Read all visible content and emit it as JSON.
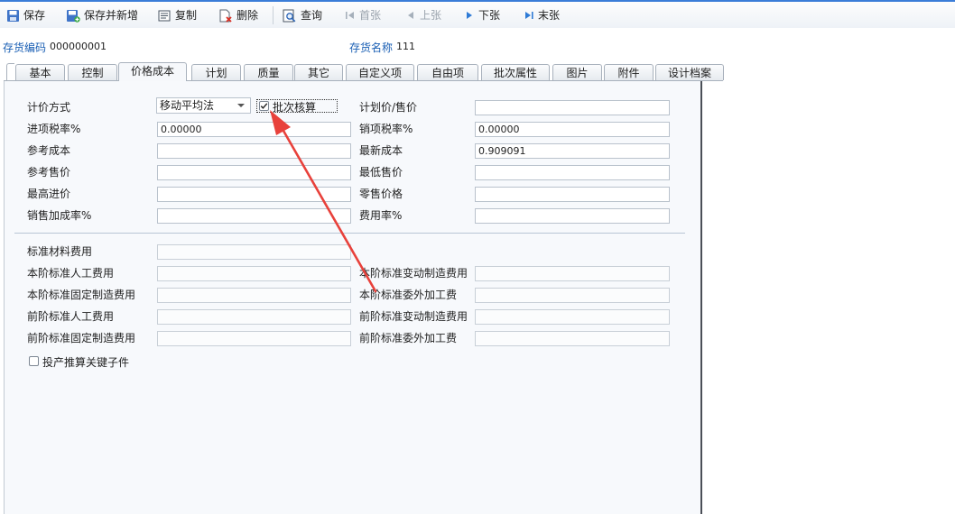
{
  "toolbar": {
    "save": "保存",
    "save_new": "保存并新增",
    "copy": "复制",
    "delete": "删除",
    "query": "查询",
    "first": "首张",
    "prev": "上张",
    "next": "下张",
    "last": "末张"
  },
  "header": {
    "code_label": "存货编码",
    "code_value": "000000001",
    "name_label": "存货名称",
    "name_value": "111"
  },
  "tabs": [
    "基本",
    "控制",
    "价格成本",
    "计划",
    "质量",
    "其它",
    "自定义项",
    "自由项",
    "批次属性",
    "图片",
    "附件",
    "设计档案"
  ],
  "active_tab": "价格成本",
  "form": {
    "pricing_method_label": "计价方式",
    "pricing_method_value": "移动平均法",
    "batch_costing_label": "批次核算",
    "batch_costing_checked": true,
    "plan_price_label": "计划价/售价",
    "plan_price_value": "",
    "input_tax_label": "进项税率%",
    "input_tax_value": "0.00000",
    "output_tax_label": "销项税率%",
    "output_tax_value": "0.00000",
    "ref_cost_label": "参考成本",
    "ref_cost_value": "",
    "latest_cost_label": "最新成本",
    "latest_cost_value": "0.909091",
    "ref_price_label": "参考售价",
    "ref_price_value": "",
    "min_price_label": "最低售价",
    "min_price_value": "",
    "max_purchase_label": "最高进价",
    "max_purchase_value": "",
    "retail_price_label": "零售价格",
    "retail_price_value": "",
    "sales_markup_label": "销售加成率%",
    "sales_markup_value": "",
    "expense_rate_label": "费用率%",
    "expense_rate_value": "",
    "std_material_label": "标准材料费用",
    "std_labor_label": "本阶标准人工费用",
    "std_var_mfg_label": "本阶标准变动制造费用",
    "std_fixed_mfg_label": "本阶标准固定制造费用",
    "std_outsource_label": "本阶标准委外加工费",
    "prev_labor_label": "前阶标准人工费用",
    "prev_var_mfg_label": "前阶标准变动制造费用",
    "prev_fixed_mfg_label": "前阶标准固定制造费用",
    "prev_outsource_label": "前阶标准委外加工费",
    "key_child_label": "投产推算关键子件",
    "key_child_checked": false
  },
  "colors": {
    "accent": "#3b7dd8",
    "header_label": "#1a5fb4",
    "arrow": "#e8413b"
  }
}
